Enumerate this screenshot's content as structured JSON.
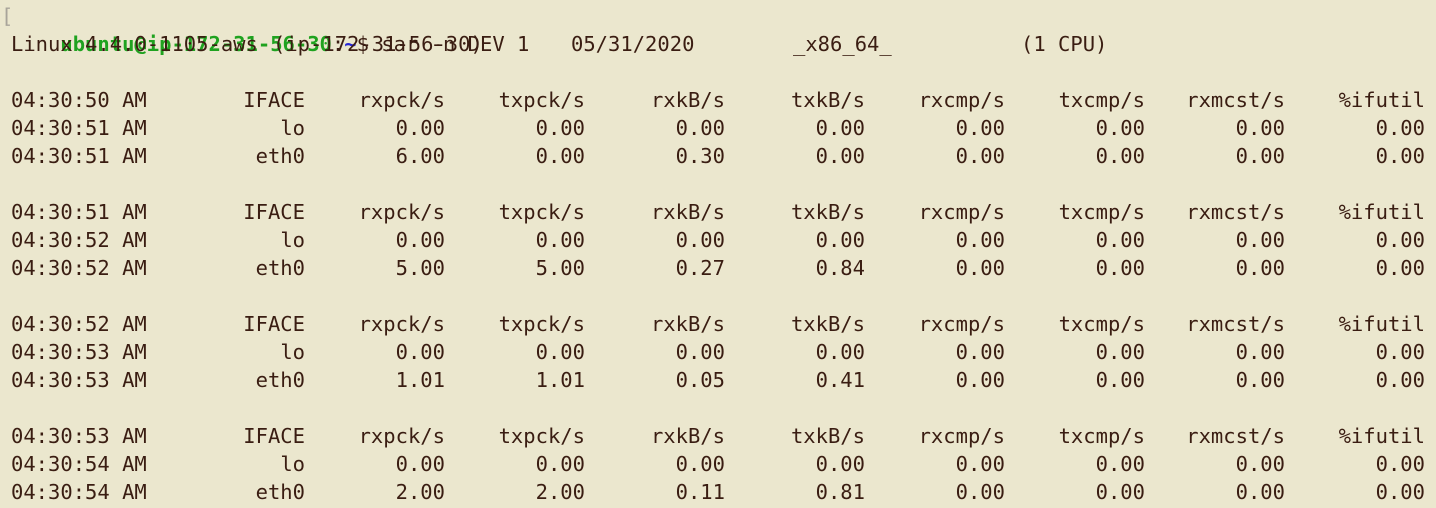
{
  "prompt": {
    "bracket": "[",
    "user_host": "ubuntu@ip-172-31-56-30",
    "colon": ":",
    "path": "~",
    "dollar": "$",
    "command": "sar -n DEV 1"
  },
  "sysinfo": {
    "kernel": "Linux 4.4.0-1105-aws",
    "host": "(ip-172-31-56-30)",
    "date": "05/31/2020",
    "arch": "_x86_64_",
    "cpu": "(1 CPU)"
  },
  "columns": [
    "IFACE",
    "rxpck/s",
    "txpck/s",
    "rxkB/s",
    "txkB/s",
    "rxcmp/s",
    "txcmp/s",
    "rxmcst/s",
    "%ifutil"
  ],
  "blocks": [
    {
      "header_time": "04:30:50 AM",
      "rows": [
        {
          "time": "04:30:51 AM",
          "cells": [
            "lo",
            "0.00",
            "0.00",
            "0.00",
            "0.00",
            "0.00",
            "0.00",
            "0.00",
            "0.00"
          ]
        },
        {
          "time": "04:30:51 AM",
          "cells": [
            "eth0",
            "6.00",
            "0.00",
            "0.30",
            "0.00",
            "0.00",
            "0.00",
            "0.00",
            "0.00"
          ]
        }
      ]
    },
    {
      "header_time": "04:30:51 AM",
      "rows": [
        {
          "time": "04:30:52 AM",
          "cells": [
            "lo",
            "0.00",
            "0.00",
            "0.00",
            "0.00",
            "0.00",
            "0.00",
            "0.00",
            "0.00"
          ]
        },
        {
          "time": "04:30:52 AM",
          "cells": [
            "eth0",
            "5.00",
            "5.00",
            "0.27",
            "0.84",
            "0.00",
            "0.00",
            "0.00",
            "0.00"
          ]
        }
      ]
    },
    {
      "header_time": "04:30:52 AM",
      "rows": [
        {
          "time": "04:30:53 AM",
          "cells": [
            "lo",
            "0.00",
            "0.00",
            "0.00",
            "0.00",
            "0.00",
            "0.00",
            "0.00",
            "0.00"
          ]
        },
        {
          "time": "04:30:53 AM",
          "cells": [
            "eth0",
            "1.01",
            "1.01",
            "0.05",
            "0.41",
            "0.00",
            "0.00",
            "0.00",
            "0.00"
          ]
        }
      ]
    },
    {
      "header_time": "04:30:53 AM",
      "rows": [
        {
          "time": "04:30:54 AM",
          "cells": [
            "lo",
            "0.00",
            "0.00",
            "0.00",
            "0.00",
            "0.00",
            "0.00",
            "0.00",
            "0.00"
          ]
        },
        {
          "time": "04:30:54 AM",
          "cells": [
            "eth0",
            "2.00",
            "2.00",
            "0.11",
            "0.81",
            "0.00",
            "0.00",
            "0.00",
            "0.00"
          ]
        }
      ]
    }
  ]
}
